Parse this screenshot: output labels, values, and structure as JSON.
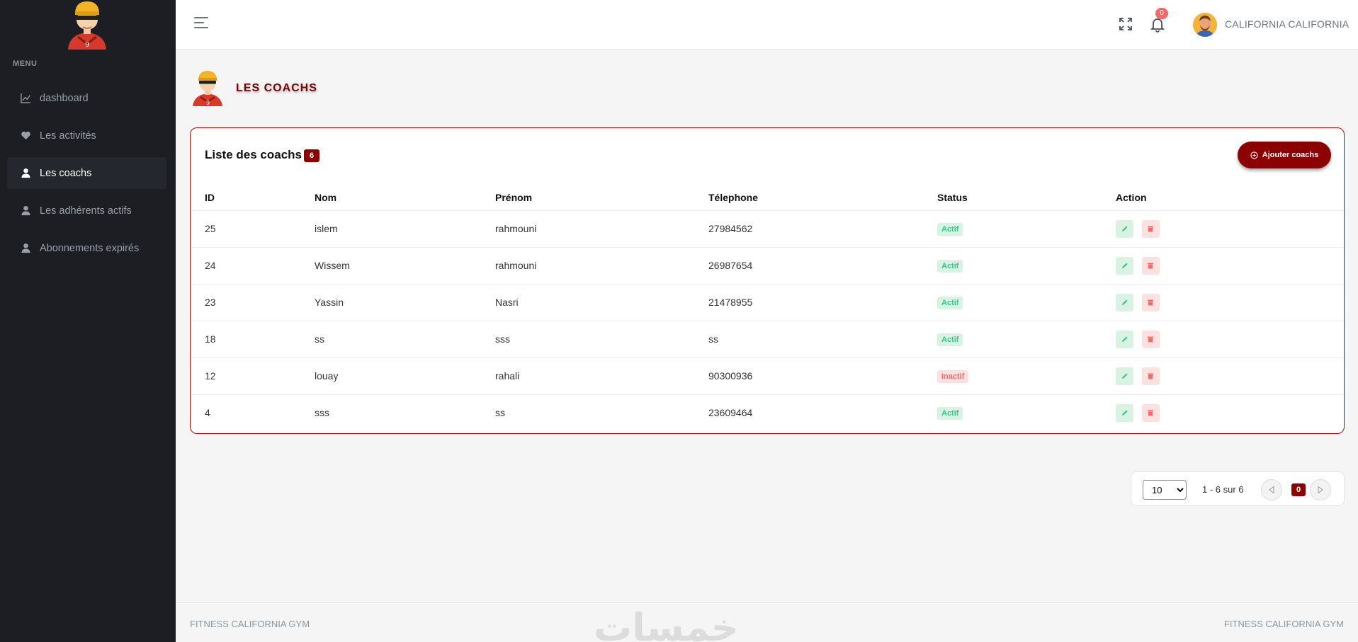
{
  "sidebar": {
    "menu_title": "MENU",
    "items": [
      {
        "label": "dashboard",
        "icon": "chart-line-icon"
      },
      {
        "label": "Les activités",
        "icon": "heart-icon"
      },
      {
        "label": "Les coachs",
        "icon": "user-icon",
        "active": true
      },
      {
        "label": "Les adhérents actifs",
        "icon": "user-icon"
      },
      {
        "label": "Abonnements expirés",
        "icon": "user-icon"
      }
    ]
  },
  "topbar": {
    "notification_count": "0",
    "username": "CALIFORNIA CALIFORNIA"
  },
  "page": {
    "title": "LES COACHS"
  },
  "card": {
    "title": "Liste des coachs",
    "count": "6",
    "add_button": "Ajouter coachs"
  },
  "table": {
    "headers": [
      "ID",
      "Nom",
      "Prénom",
      "Télephone",
      "Status",
      "Action"
    ],
    "rows": [
      {
        "id": "25",
        "nom": "islem",
        "prenom": "rahmouni",
        "tel": "27984562",
        "status": "Actif"
      },
      {
        "id": "24",
        "nom": "Wissem",
        "prenom": "rahmouni",
        "tel": "26987654",
        "status": "Actif"
      },
      {
        "id": "23",
        "nom": "Yassin",
        "prenom": "Nasri",
        "tel": "21478955",
        "status": "Actif"
      },
      {
        "id": "18",
        "nom": "ss",
        "prenom": "sss",
        "tel": "ss",
        "status": "Actif"
      },
      {
        "id": "12",
        "nom": "louay",
        "prenom": "rahali",
        "tel": "90300936",
        "status": "Inactif"
      },
      {
        "id": "4",
        "nom": "sss",
        "prenom": "ss",
        "tel": "23609464",
        "status": "Actif"
      }
    ]
  },
  "pagination": {
    "page_size": "10",
    "range": "1 - 6 sur 6",
    "current_page": "0"
  },
  "footer": {
    "left": "FITNESS CALIFORNIA GYM",
    "right": "FITNESS CALIFORNIA GYM",
    "watermark": "خمسات"
  },
  "colors": {
    "sidebar_bg": "#1c1e24",
    "brand": "#8b0000",
    "success": "#34c38f",
    "danger": "#f46a6a"
  }
}
